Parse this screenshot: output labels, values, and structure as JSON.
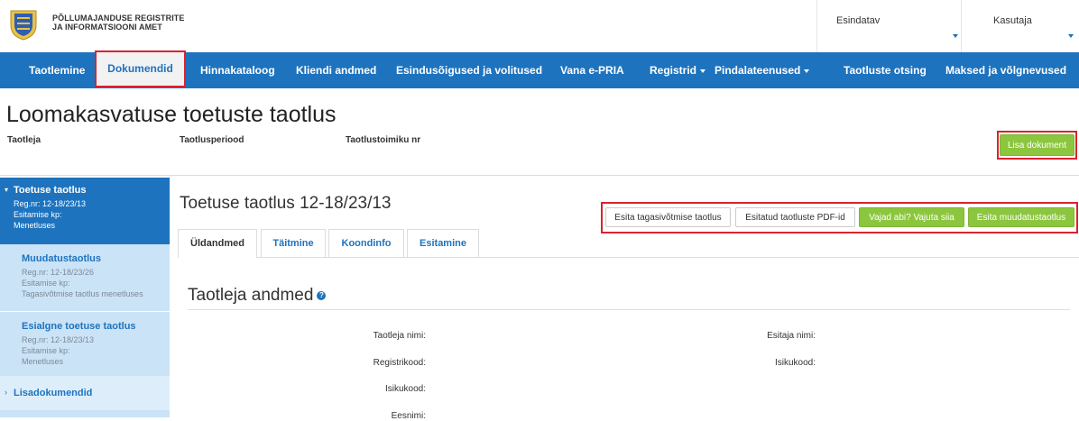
{
  "header": {
    "org_line1": "PÕLLUMAJANDUSE REGISTRITE",
    "org_line2": "JA INFORMATSIOONI AMET",
    "esindatav_label": "Esindatav",
    "kasutaja_label": "Kasutaja"
  },
  "nav": {
    "items": [
      "Taotlemine",
      "Dokumendid",
      "Hinnakataloog",
      "Kliendi andmed",
      "Esindusõigused ja volitused",
      "Vana e-PRIA",
      "Registrid",
      "Pindalateenused",
      "Taotluste otsing",
      "Maksed ja võlgnevused"
    ],
    "active": "Dokumendid"
  },
  "page": {
    "title": "Loomakasvatuse toetuste taotlus",
    "meta": [
      "Taotleja",
      "Taotlusperiood",
      "Taotlustoimiku nr"
    ],
    "add_document_button": "Lisa dokument"
  },
  "sidebar": {
    "active": {
      "title": "Toetuse taotlus",
      "lines": [
        "Reg.nr: 12-18/23/13",
        "Esitamise kp:",
        "Menetluses"
      ]
    },
    "items": [
      {
        "title": "Muudatustaotlus",
        "lines": [
          "Reg.nr: 12-18/23/26",
          "Esitamise kp:",
          "Tagasivõtmise taotlus menetluses"
        ]
      },
      {
        "title": "Esialgne toetuse taotlus",
        "lines": [
          "Reg.nr: 12-18/23/13",
          "Esitamise kp:",
          "Menetluses"
        ]
      }
    ],
    "extra": "Lisadokumendid"
  },
  "main": {
    "title": "Toetuse taotlus 12-18/23/13",
    "buttons": [
      "Esita tagasivõtmise taotlus",
      "Esitatud taotluste PDF-id",
      "Vajad abi? Vajuta siia",
      "Esita muudatustaotlus"
    ],
    "tabs": [
      "Üldandmed",
      "Täitmine",
      "Koondinfo",
      "Esitamine"
    ],
    "section_title": "Taotleja andmed",
    "help_glyph": "?",
    "left_fields": [
      "Taotleja nimi:",
      "Registrikood:",
      "Isikukood:",
      "Eesnimi:"
    ],
    "right_fields": [
      "Esitaja nimi:",
      "Isikukood:"
    ]
  },
  "colors": {
    "brand_blue": "#1e73be",
    "green": "#8cc63e",
    "highlight_red": "#d9232f"
  }
}
